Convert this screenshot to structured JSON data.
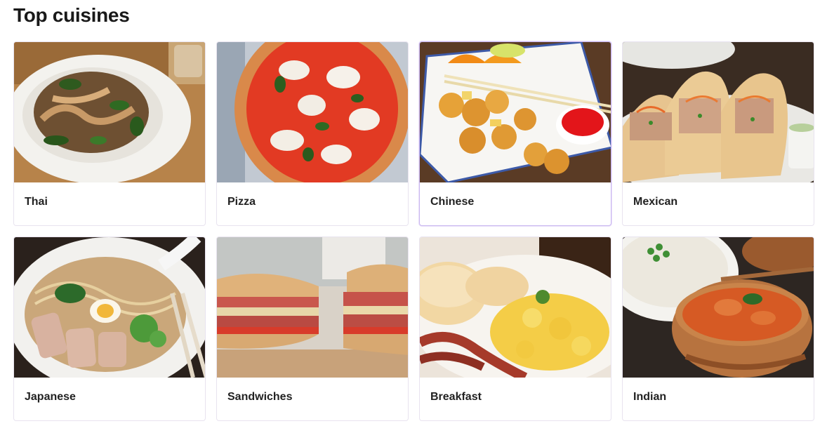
{
  "section": {
    "title": "Top cuisines"
  },
  "cuisines": [
    {
      "label": "Thai",
      "image_icon": "pad-see-ew-photo"
    },
    {
      "label": "Pizza",
      "image_icon": "margherita-pizza-photo"
    },
    {
      "label": "Chinese",
      "image_icon": "sweet-sour-chicken-photo"
    },
    {
      "label": "Mexican",
      "image_icon": "tacos-photo"
    },
    {
      "label": "Japanese",
      "image_icon": "ramen-photo"
    },
    {
      "label": "Sandwiches",
      "image_icon": "deli-sandwich-photo"
    },
    {
      "label": "Breakfast",
      "image_icon": "breakfast-plate-photo"
    },
    {
      "label": "Indian",
      "image_icon": "curry-pot-photo"
    }
  ],
  "colors": {
    "card_border": "#e8e3ef",
    "hover_border": "#c9b8ef",
    "text": "#191919"
  }
}
